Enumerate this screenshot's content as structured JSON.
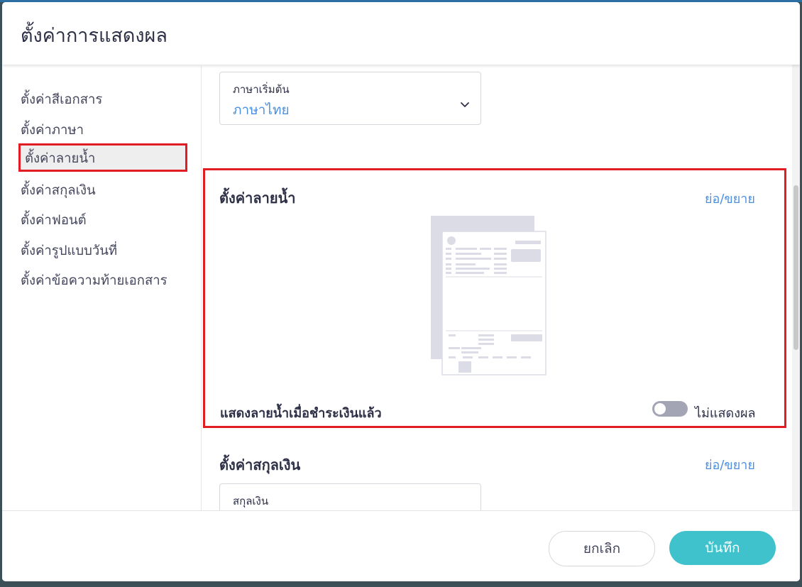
{
  "dialog": {
    "title": "ตั้งค่าการแสดงผล"
  },
  "sidebar": {
    "items": [
      {
        "label": "ตั้งค่าสีเอกสาร"
      },
      {
        "label": "ตั้งค่าภาษา"
      },
      {
        "label": "ตั้งค่าลายน้ำ",
        "active": true
      },
      {
        "label": "ตั้งค่าสกุลเงิน"
      },
      {
        "label": "ตั้งค่าฟอนต์"
      },
      {
        "label": "ตั้งค่ารูปแบบวันที่"
      },
      {
        "label": "ตั้งค่าข้อความท้ายเอกสาร"
      }
    ]
  },
  "language": {
    "field_label": "ภาษาเริ่มต้น",
    "field_value": "ภาษาไทย"
  },
  "watermark": {
    "section_title": "ตั้งค่าลายน้ำ",
    "collapse_label": "ย่อ/ขยาย",
    "toggle_label": "แสดงลายน้ำเมื่อชำระเงินแล้ว",
    "toggle_on": false,
    "toggle_state_text": "ไม่แสดงผล"
  },
  "currency": {
    "section_title": "ตั้งค่าสกุลเงิน",
    "collapse_label": "ย่อ/ขยาย",
    "field_label": "สกุลเงิน"
  },
  "footer": {
    "cancel_label": "ยกเลิก",
    "save_label": "บันทึก"
  },
  "colors": {
    "accent": "#3fc2cc",
    "link": "#4a90e2",
    "highlight": "#e31b23"
  }
}
